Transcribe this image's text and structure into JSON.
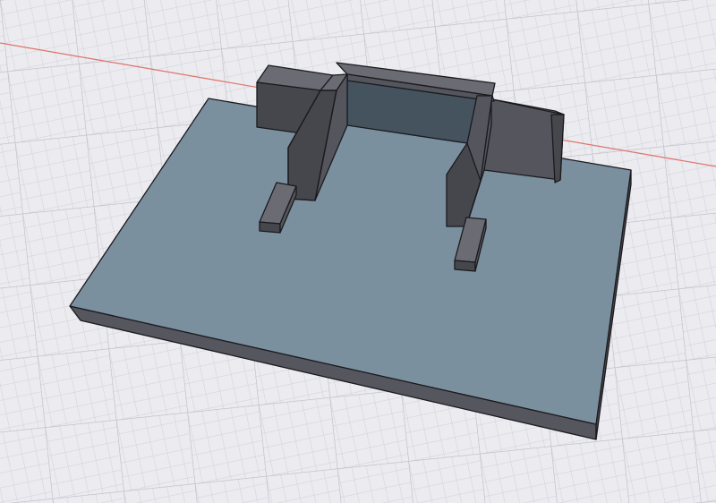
{
  "viewport": {
    "background": "#ebebf0",
    "grid": {
      "visible": true,
      "minor_color": "#cfd0d8",
      "major_color": "#babbc6"
    },
    "axis": {
      "visible": true,
      "color": "#e0736a"
    }
  },
  "model": {
    "base_plate": {
      "top_color": "#7b909e",
      "front_color": "#56565f",
      "side_color": "#4b4c53",
      "edge_color": "#1a1a1e"
    },
    "fixture": {
      "top_color": "#6b6b74",
      "face_color": "#55555d",
      "dark_color": "#46464d",
      "inner_wall_color": "#44535e",
      "edge_color": "#1a1a1e"
    }
  }
}
